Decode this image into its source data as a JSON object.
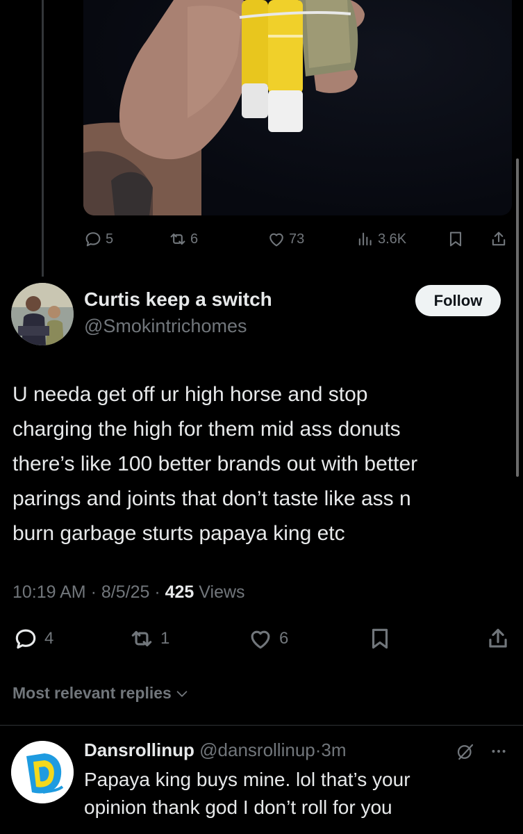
{
  "parent_tweet": {
    "media": {
      "alt": "photo",
      "icon": "photo-media"
    },
    "actions": {
      "replies": "5",
      "reposts": "6",
      "likes": "73",
      "views": "3.6K"
    }
  },
  "tweet": {
    "author": {
      "name": "Curtis keep a switch",
      "handle": "@Smokintrichomes"
    },
    "follow_label": "Follow",
    "text_lines": [
      "U needa get off ur high horse and stop",
      "charging the high for them mid ass donuts",
      "there’s like 100 better brands out with better",
      "parings and joints that don’t taste like ass n",
      "burn garbage  sturts papaya king etc"
    ],
    "time": "10:19 AM",
    "date": "8/5/25",
    "views_count": "425",
    "views_label": "Views",
    "sep": "·",
    "actions": {
      "replies": "4",
      "reposts": "1",
      "likes": "6"
    }
  },
  "sort_label": "Most relevant replies",
  "reply": {
    "name": "Dansrollinup",
    "handle": "@dansrollinup",
    "sep": "·",
    "time": "3m",
    "text_lines": [
      "Papaya king buys mine. lol that’s your",
      "opinion thank god I don’t roll for you"
    ]
  },
  "colors": {
    "background": "#000000",
    "text": "#e7e9ea",
    "muted": "#71767b",
    "divider": "#2f3336",
    "follow_bg": "#eff3f4"
  }
}
